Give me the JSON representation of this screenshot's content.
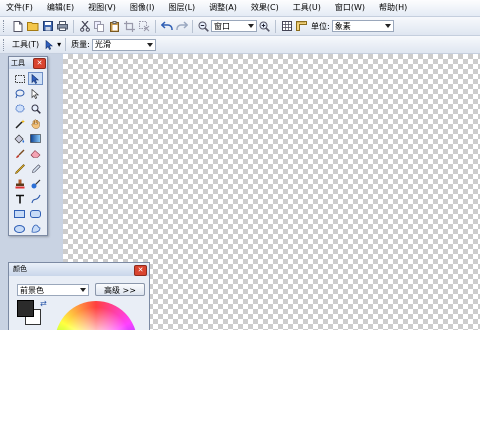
{
  "menubar": {
    "items": [
      "文件(F)",
      "编辑(E)",
      "视图(V)",
      "图像(I)",
      "图层(L)",
      "调整(A)",
      "效果(C)",
      "工具(U)",
      "窗口(W)",
      "帮助(H)"
    ]
  },
  "toolbar": {
    "zoom_value": "窗口",
    "units_label": "单位:",
    "units_value": "象素"
  },
  "tool_options": {
    "tool_label": "工具(T)",
    "quality_label": "质量:",
    "quality_value": "光滑"
  },
  "tools_window": {
    "title": "工具"
  },
  "colors_window": {
    "title": "颜色",
    "target_value": "前景色",
    "advanced_label": "高级 >>"
  },
  "colors": {
    "primary": "#2b2b2b",
    "secondary": "#ffffff",
    "accent": "#d9442f"
  }
}
